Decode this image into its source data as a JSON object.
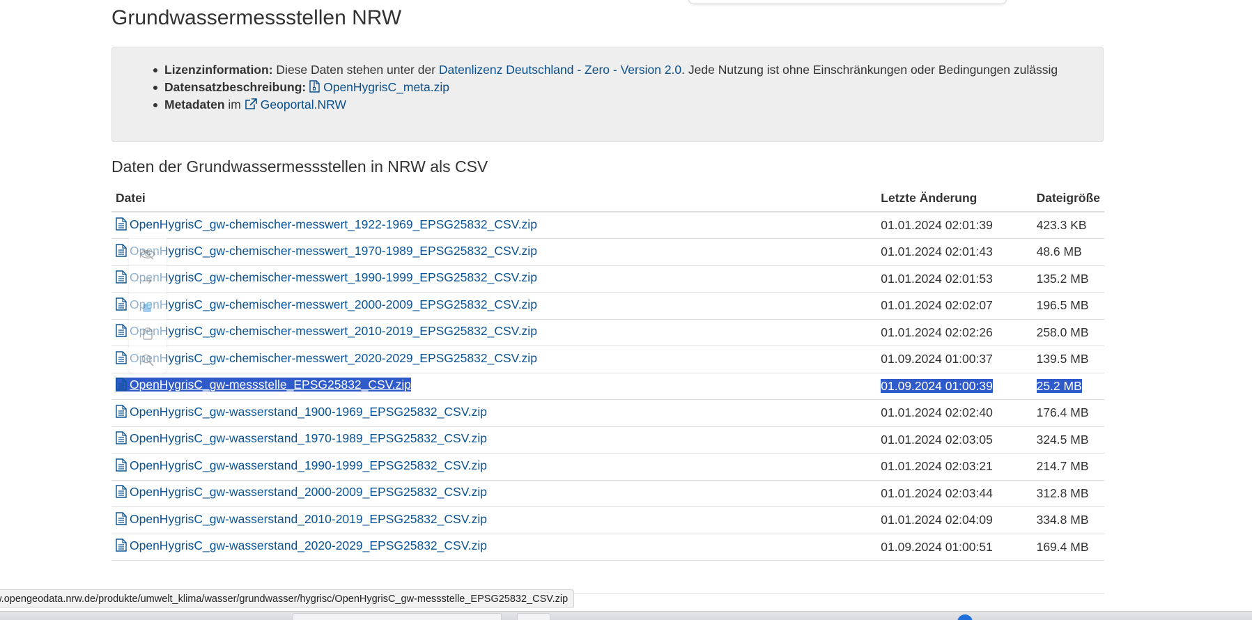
{
  "page": {
    "title": "Grundwassermessstellen NRW"
  },
  "info": {
    "license_label": "Lizenzinformation:",
    "license_text_pre": "Diese Daten stehen unter der",
    "license_link": "Datenlizenz Deutschland - Zero - Version 2.0",
    "license_text_post": ". Jede Nutzung ist ohne Einschränkungen oder Bedingungen zulässig",
    "description_label": "Datensatzbeschreibung:",
    "description_link": "OpenHygrisC_meta.zip",
    "metadata_label": "Metadaten",
    "metadata_mid": "im",
    "metadata_link": "Geoportal.NRW"
  },
  "section": {
    "title": "Daten der Grundwassermessstellen in NRW als CSV"
  },
  "table": {
    "headers": {
      "file": "Datei",
      "modified": "Letzte Änderung",
      "size": "Dateigröße"
    },
    "rows": [
      {
        "name": "OpenHygrisC_gw-chemischer-messwert_1922-1969_EPSG25832_CSV.zip",
        "modified": "01.01.2024 02:01:39",
        "size": "423.3 KB"
      },
      {
        "name": "OpenHygrisC_gw-chemischer-messwert_1970-1989_EPSG25832_CSV.zip",
        "modified": "01.01.2024 02:01:43",
        "size": "48.6 MB"
      },
      {
        "name": "OpenHygrisC_gw-chemischer-messwert_1990-1999_EPSG25832_CSV.zip",
        "modified": "01.01.2024 02:01:53",
        "size": "135.2 MB"
      },
      {
        "name": "OpenHygrisC_gw-chemischer-messwert_2000-2009_EPSG25832_CSV.zip",
        "modified": "01.01.2024 02:02:07",
        "size": "196.5 MB"
      },
      {
        "name": "OpenHygrisC_gw-chemischer-messwert_2010-2019_EPSG25832_CSV.zip",
        "modified": "01.01.2024 02:02:26",
        "size": "258.0 MB"
      },
      {
        "name": "OpenHygrisC_gw-chemischer-messwert_2020-2029_EPSG25832_CSV.zip",
        "modified": "01.09.2024 01:00:37",
        "size": "139.5 MB"
      },
      {
        "name": "OpenHygrisC_gw-messstelle_EPSG25832_CSV.zip",
        "modified": "01.09.2024 01:00:39",
        "size": "25.2 MB"
      },
      {
        "name": "OpenHygrisC_gw-wasserstand_1900-1969_EPSG25832_CSV.zip",
        "modified": "01.01.2024 02:02:40",
        "size": "176.4 MB"
      },
      {
        "name": "OpenHygrisC_gw-wasserstand_1970-1989_EPSG25832_CSV.zip",
        "modified": "01.01.2024 02:03:05",
        "size": "324.5 MB"
      },
      {
        "name": "OpenHygrisC_gw-wasserstand_1990-1999_EPSG25832_CSV.zip",
        "modified": "01.01.2024 02:03:21",
        "size": "214.7 MB"
      },
      {
        "name": "OpenHygrisC_gw-wasserstand_2000-2009_EPSG25832_CSV.zip",
        "modified": "01.01.2024 02:03:44",
        "size": "312.8 MB"
      },
      {
        "name": "OpenHygrisC_gw-wasserstand_2010-2019_EPSG25832_CSV.zip",
        "modified": "01.01.2024 02:04:09",
        "size": "334.8 MB"
      },
      {
        "name": "OpenHygrisC_gw-wasserstand_2020-2029_EPSG25832_CSV.zip",
        "modified": "01.09.2024 01:00:51",
        "size": "169.4 MB"
      }
    ]
  },
  "selection": {
    "row_index": 6
  },
  "status_bar": {
    "url": "w.opengeodata.nrw.de/produkte/umwelt_klima/wasser/grundwasser/hygrisc/OpenHygrisC_gw-messstelle_EPSG25832_CSV.zip"
  },
  "floating_toolbar": {
    "icons": [
      "eye-off-icon",
      "arrow-icon",
      "extension-icon",
      "clipboard-icon",
      "search-icon"
    ]
  },
  "colors": {
    "link": "#0b5394",
    "selection": "#2f5ac9",
    "well_background": "#eeeeee"
  }
}
